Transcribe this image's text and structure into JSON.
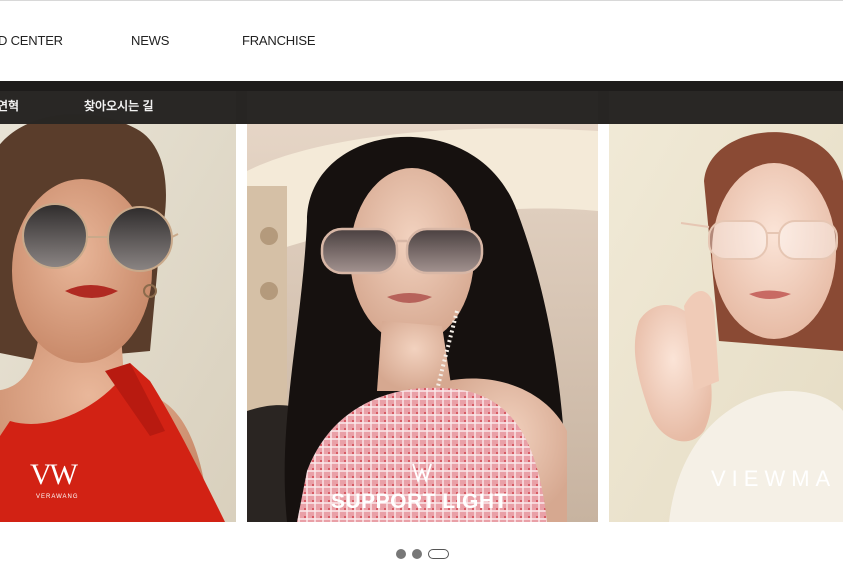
{
  "nav": {
    "items": [
      {
        "label": "D CENTER"
      },
      {
        "label": "NEWS"
      },
      {
        "label": "FRANCHISE"
      }
    ]
  },
  "subnav": {
    "items": [
      {
        "label": "연혁"
      },
      {
        "label": "찾아오시는 길"
      }
    ]
  },
  "slides": [
    {
      "brand": "VW",
      "brand_sub": "VERAWANG"
    },
    {
      "brand": "SUPPORT LIGHT"
    },
    {
      "brand": "VIEWMA"
    }
  ],
  "carousel": {
    "active_index": 3,
    "total": 3
  }
}
